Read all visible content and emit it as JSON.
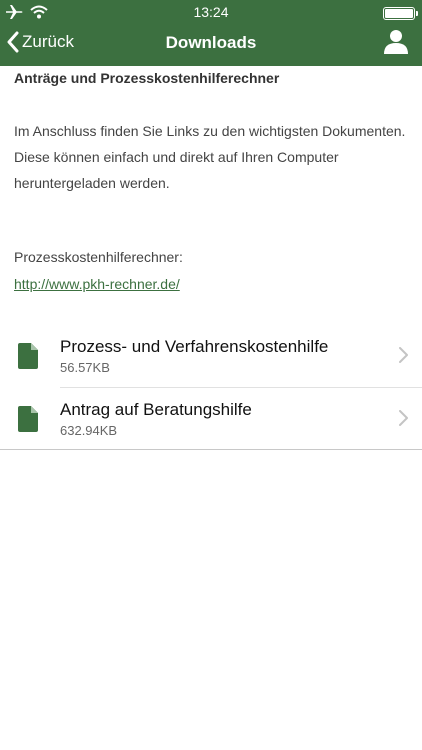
{
  "status_bar": {
    "time": "13:24",
    "icons": [
      "airplane-icon",
      "wifi-icon",
      "battery-icon"
    ]
  },
  "navbar": {
    "back_label": "Zurück",
    "title": "Downloads",
    "profile_icon": "user-icon"
  },
  "content": {
    "section_title": "Anträge und Prozesskostenhilferechner",
    "intro": "Im Anschluss finden Sie Links zu den wichtigsten Dokumenten. Diese können einfach und direkt auf Ihren Computer heruntergeladen werden.",
    "calculator_label": "Prozesskostenhilferechner:",
    "calculator_link": "http://www.pkh-rechner.de/"
  },
  "downloads": [
    {
      "title": "Prozess- und Verfahrenskostenhilfe",
      "size": "56.57KB"
    },
    {
      "title": "Antrag auf Beratungshilfe",
      "size": "632.94KB"
    }
  ],
  "colors": {
    "brand_green": "#3c7040",
    "link_green": "#3c7040",
    "divider": "#e1e1e1"
  }
}
